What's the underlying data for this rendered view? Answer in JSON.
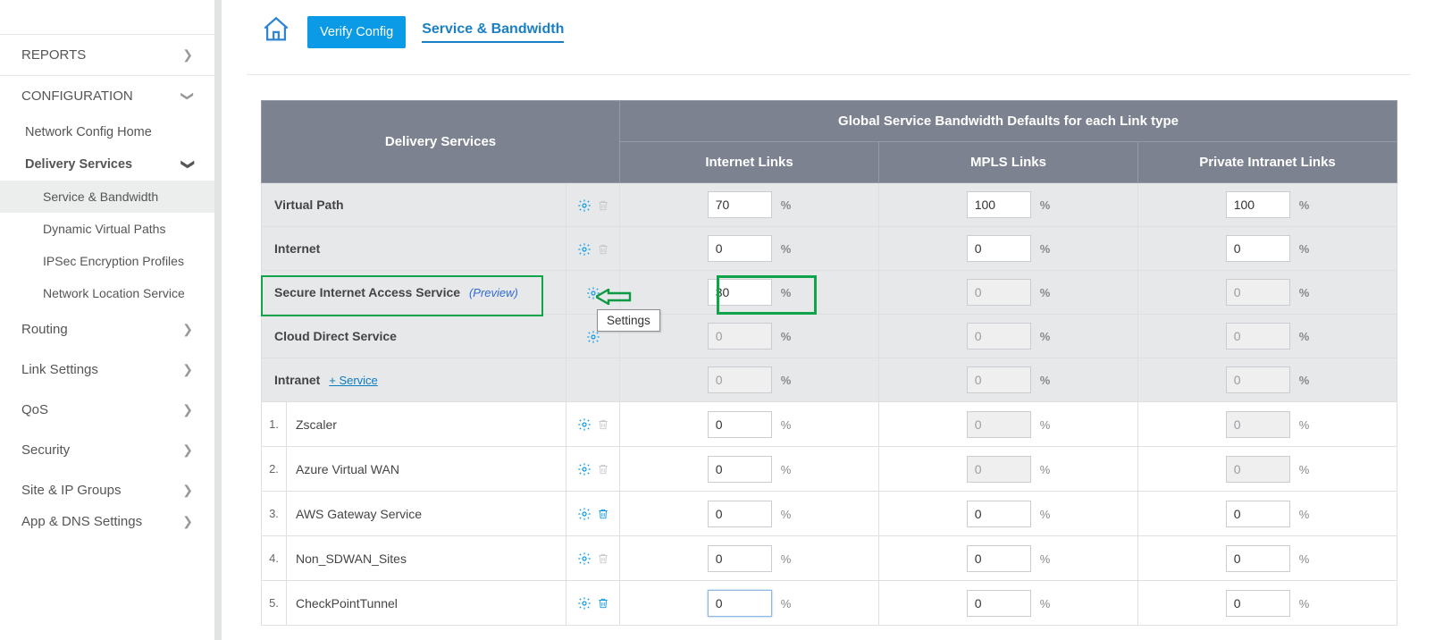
{
  "sidebar": {
    "reports": "REPORTS",
    "configuration": "CONFIGURATION",
    "network_config_home": "Network Config Home",
    "delivery_services": "Delivery Services",
    "ds_items": [
      "Service & Bandwidth",
      "Dynamic Virtual Paths",
      "IPSec Encryption Profiles",
      "Network Location Service"
    ],
    "routing": "Routing",
    "link_settings": "Link Settings",
    "qos": "QoS",
    "security": "Security",
    "site_ip": "Site & IP Groups",
    "app_dns": "App & DNS Settings"
  },
  "topbar": {
    "verify": "Verify Config",
    "crumb": "Service & Bandwidth"
  },
  "table": {
    "head_ds": "Delivery Services",
    "head_global": "Global Service Bandwidth Defaults for each Link type",
    "head_internet": "Internet Links",
    "head_mpls": "MPLS Links",
    "head_private": "Private Intranet Links",
    "rows": [
      {
        "name": "Virtual Path",
        "gear": true,
        "trash": "disabled",
        "int": "70",
        "int_dis": false,
        "mpls": "100",
        "mpls_dis": false,
        "pri": "100",
        "pri_dis": false
      },
      {
        "name": "Internet",
        "gear": true,
        "trash": "disabled",
        "int": "0",
        "int_dis": false,
        "mpls": "0",
        "mpls_dis": false,
        "pri": "0",
        "pri_dis": false
      },
      {
        "name": "Secure Internet Access Service",
        "preview": "(Preview)",
        "gear": true,
        "trash": "none",
        "int": "30",
        "int_dis": false,
        "mpls": "0",
        "mpls_dis": true,
        "pri": "0",
        "pri_dis": true
      },
      {
        "name": "Cloud Direct Service",
        "gear": true,
        "trash": "none",
        "int": "0",
        "int_dis": true,
        "mpls": "0",
        "mpls_dis": true,
        "pri": "0",
        "pri_dis": true
      },
      {
        "name": "Intranet",
        "add_service": "+ Service",
        "gear": false,
        "trash": "none",
        "int": "0",
        "int_dis": true,
        "mpls": "0",
        "mpls_dis": true,
        "pri": "0",
        "pri_dis": true
      }
    ],
    "subrows": [
      {
        "idx": "1.",
        "name": "Zscaler",
        "trash": "disabled",
        "int": "0",
        "int_dis": false,
        "mpls": "0",
        "mpls_dis": true,
        "pri": "0",
        "pri_dis": true
      },
      {
        "idx": "2.",
        "name": "Azure Virtual WAN",
        "trash": "disabled",
        "int": "0",
        "int_dis": false,
        "mpls": "0",
        "mpls_dis": true,
        "pri": "0",
        "pri_dis": true
      },
      {
        "idx": "3.",
        "name": "AWS Gateway Service",
        "trash": "enabled",
        "int": "0",
        "int_dis": false,
        "mpls": "0",
        "mpls_dis": false,
        "pri": "0",
        "pri_dis": false
      },
      {
        "idx": "4.",
        "name": "Non_SDWAN_Sites",
        "trash": "disabled",
        "int": "0",
        "int_dis": false,
        "mpls": "0",
        "mpls_dis": false,
        "pri": "0",
        "pri_dis": false
      },
      {
        "idx": "5.",
        "name": "CheckPointTunnel",
        "trash": "enabled",
        "int": "0",
        "int_dis": false,
        "int_focus": true,
        "mpls": "0",
        "mpls_dis": false,
        "pri": "0",
        "pri_dis": false
      }
    ],
    "pct": "%"
  },
  "tooltip": "Settings"
}
